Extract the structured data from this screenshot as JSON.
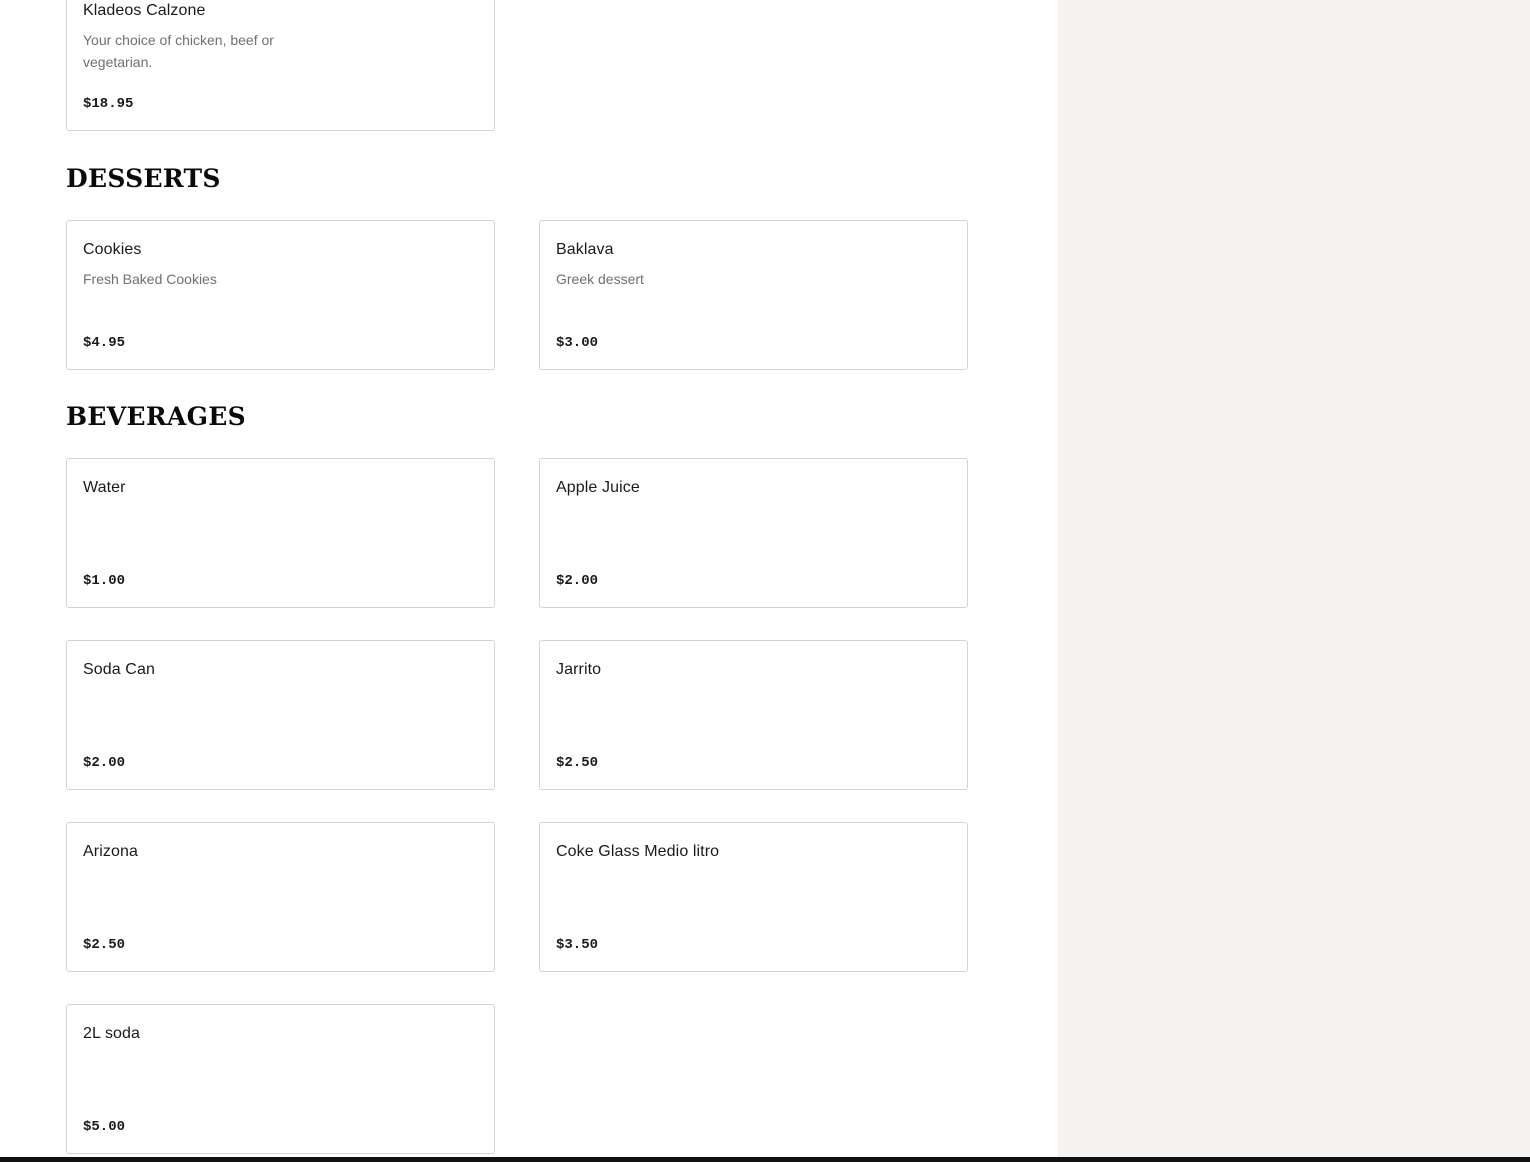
{
  "sections": {
    "top": {
      "items": [
        {
          "name": "Kladeos Calzone",
          "description": "Your choice of chicken, beef or vegetarian.",
          "price": "$18.95"
        }
      ]
    },
    "desserts": {
      "title": "DESSERTS",
      "items": [
        {
          "name": "Cookies",
          "description": "Fresh Baked Cookies",
          "price": "$4.95"
        },
        {
          "name": "Baklava",
          "description": "Greek dessert",
          "price": "$3.00"
        }
      ]
    },
    "beverages": {
      "title": "BEVERAGES",
      "items": [
        {
          "name": "Water",
          "description": "",
          "price": "$1.00"
        },
        {
          "name": "Apple Juice",
          "description": "",
          "price": "$2.00"
        },
        {
          "name": "Soda Can",
          "description": "",
          "price": "$2.00"
        },
        {
          "name": "Jarrito",
          "description": "",
          "price": "$2.50"
        },
        {
          "name": "Arizona",
          "description": "",
          "price": "$2.50"
        },
        {
          "name": "Coke Glass Medio litro",
          "description": "",
          "price": "$3.50"
        },
        {
          "name": "2L soda",
          "description": "",
          "price": "$5.00"
        }
      ]
    }
  },
  "colors": {
    "panel_bg": "#f4f3f1",
    "card_border": "#d4d4d4",
    "description_text": "#707070"
  }
}
